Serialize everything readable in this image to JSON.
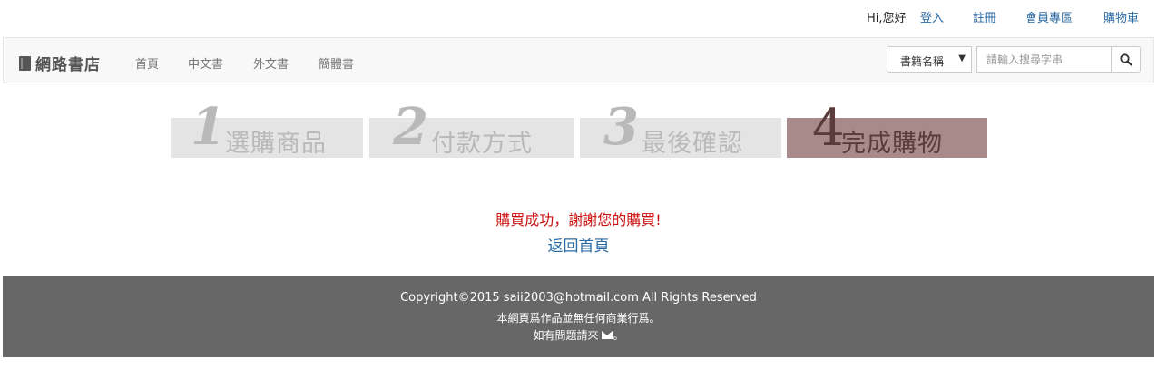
{
  "topbar": {
    "greeting": "Hi,您好",
    "login": "登入",
    "register": "註冊",
    "member": "會員專區",
    "cart": "購物車"
  },
  "navbar": {
    "brand": "網路書店",
    "links": [
      "首頁",
      "中文書",
      "外文書",
      "簡體書"
    ],
    "search_category": "書籍名稱",
    "search_placeholder": "請輸入搜尋字串"
  },
  "steps": [
    {
      "num": "1",
      "label": "選購商品",
      "active": false
    },
    {
      "num": "2",
      "label": "付款方式",
      "active": false
    },
    {
      "num": "3",
      "label": "最後確認",
      "active": false
    },
    {
      "num": "4",
      "label": "完成購物",
      "active": true
    }
  ],
  "main": {
    "message": "購買成功，謝謝您的購買!",
    "back_link": "返回首頁"
  },
  "footer": {
    "copyright": "Copyright©2015 saii2003@hotmail.com All Rights Reserved",
    "notice": "本網頁爲作品並無任何商業行爲。",
    "contact": "如有問題請來",
    "contact_end": "。"
  },
  "colors": {
    "active_step": "#a98a8a",
    "inactive_step": "#e4e4e4",
    "success_text": "#cc1111",
    "footer_bg": "#676767"
  }
}
